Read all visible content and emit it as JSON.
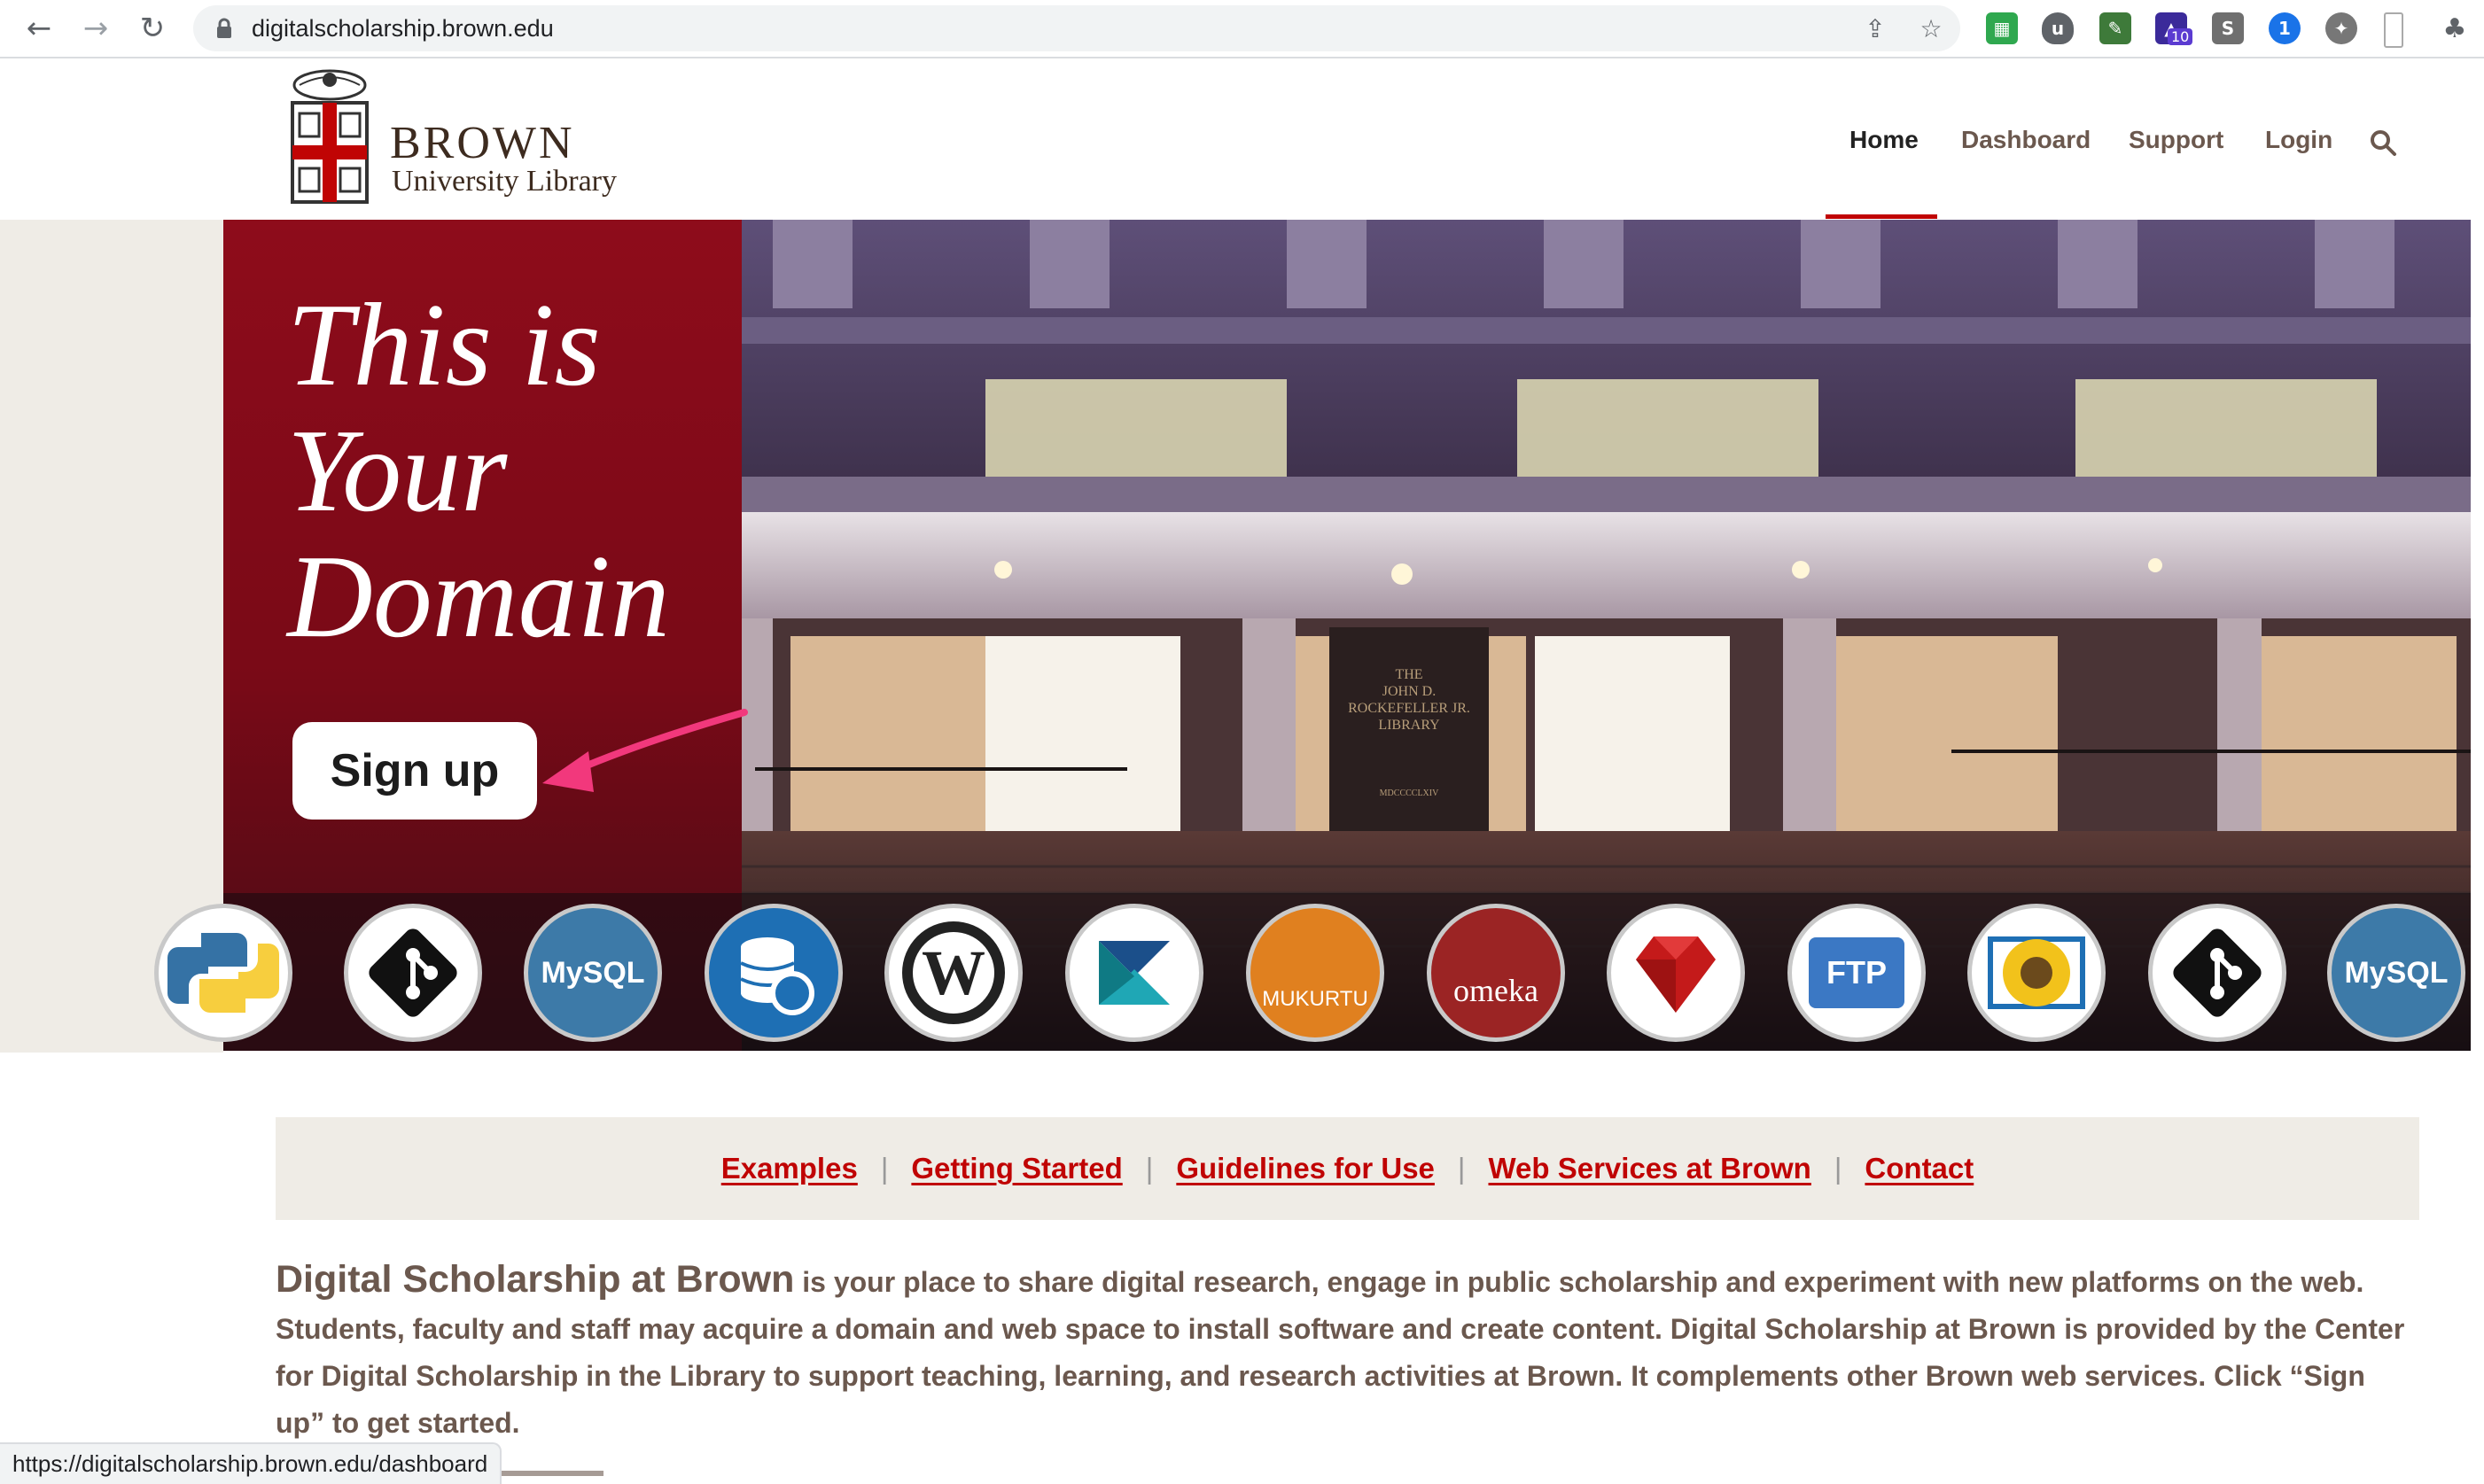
{
  "browser": {
    "url": "digitalscholarship.brown.edu",
    "status_url": "https://digitalscholarship.brown.edu/dashboard",
    "extension_badge": "10",
    "icons": [
      "back-icon",
      "forward-icon",
      "reload-icon",
      "lock-icon",
      "share-icon",
      "bookmark-star-icon",
      "puzzle-extensions-icon"
    ]
  },
  "logo": {
    "name": "BROWN",
    "subtitle": "University Library"
  },
  "nav": {
    "items": [
      {
        "label": "Home",
        "active": true
      },
      {
        "label": "Dashboard",
        "active": false
      },
      {
        "label": "Support",
        "active": false
      },
      {
        "label": "Login",
        "active": false
      }
    ]
  },
  "hero": {
    "headline_lines": [
      "This is",
      "Your",
      "Domain"
    ],
    "signup_label": "Sign up",
    "building_sign": [
      "THE",
      "JOHN D.",
      "ROCKEFELLER JR.",
      "LIBRARY",
      "MDCCCCLXIV"
    ]
  },
  "app_icons": [
    {
      "name": "python-icon",
      "label": ""
    },
    {
      "name": "git-icon",
      "label": ""
    },
    {
      "name": "mysql-icon",
      "label": "MySQL"
    },
    {
      "name": "database-restore-icon",
      "label": ""
    },
    {
      "name": "wordpress-icon",
      "label": ""
    },
    {
      "name": "kaltura-icon",
      "label": ""
    },
    {
      "name": "mukurtu-icon",
      "label": "MUKURTU"
    },
    {
      "name": "omeka-icon",
      "label": "omeka"
    },
    {
      "name": "ruby-icon",
      "label": ""
    },
    {
      "name": "ftp-icon",
      "label": "FTP"
    },
    {
      "name": "sunflower-icon",
      "label": ""
    },
    {
      "name": "git-icon",
      "label": ""
    },
    {
      "name": "mysql-icon",
      "label": "MySQL"
    }
  ],
  "links": [
    "Examples",
    "Getting Started",
    "Guidelines for Use",
    "Web Services at Brown",
    "Contact"
  ],
  "intro": {
    "lead": "Digital Scholarship at Brown",
    "body": " is your place to share digital research, engage in public scholarship and experiment with new platforms on the web. Students, faculty and staff may acquire a domain and web space to install software and create content. Digital Scholarship at Brown is provided by the Center for Digital Scholarship in the Library to support teaching, learning, and research activities at Brown. It complements other Brown web services. Click “Sign up” to get started."
  },
  "colors": {
    "brand_red": "#c00404",
    "text_brown": "#6b584e",
    "panel_beige": "#efece6",
    "annotation_pink": "#f2387c"
  }
}
